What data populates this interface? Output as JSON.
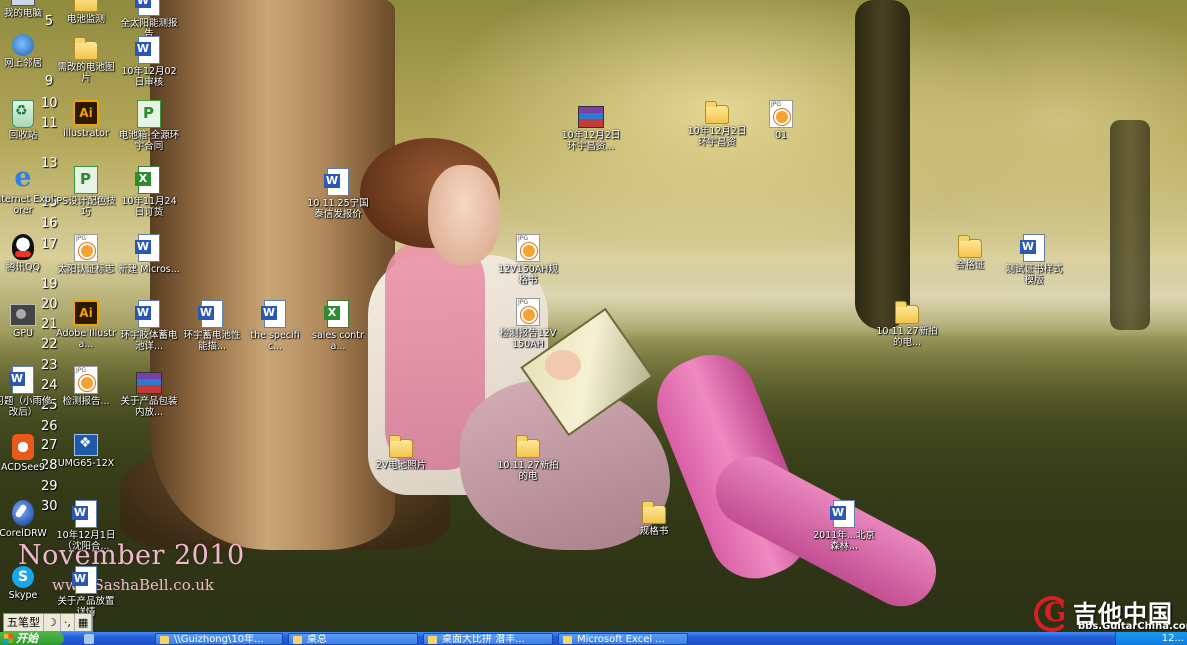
{
  "wallpaper": {
    "title": "November 2010",
    "site": "www.SashaBell.co.uk"
  },
  "left_numbers": [
    "5",
    "9",
    "10",
    "11",
    "13",
    "15",
    "16",
    "17",
    "19",
    "20",
    "21",
    "22",
    "23",
    "24",
    "25",
    "26",
    "27",
    "28",
    "29",
    "30"
  ],
  "desktop_icons": [
    {
      "label": "我的电脑",
      "icon": "computer-icon"
    },
    {
      "label": "电池监测",
      "icon": "folder-icon"
    },
    {
      "label": "全太阳能测报告",
      "icon": "word-icon"
    },
    {
      "label": "网上邻居",
      "icon": "network-icon"
    },
    {
      "label": "需改的电池图片",
      "icon": "folder-icon"
    },
    {
      "label": "10年12月02日审核",
      "icon": "word-icon"
    },
    {
      "label": "回收站",
      "icon": "recycle-bin-icon"
    },
    {
      "label": "illustrator",
      "icon": "illustrator-icon"
    },
    {
      "label": "电池箱-全源环宇合同",
      "icon": "ps-icon"
    },
    {
      "label": "Internet Explorer",
      "icon": "internet-explorer-icon"
    },
    {
      "label": "PS设计配色技巧",
      "icon": "ps-icon"
    },
    {
      "label": "10年11月24日订货",
      "icon": "excel-icon"
    },
    {
      "label": "腾讯QQ",
      "icon": "qq-icon"
    },
    {
      "label": "太阳认证标志",
      "icon": "jpg-icon"
    },
    {
      "label": "新建 Micros...",
      "icon": "word-icon"
    },
    {
      "label": "GPU",
      "icon": "gpu-icon"
    },
    {
      "label": "Adobe Illustra...",
      "icon": "illustrator-icon"
    },
    {
      "label": "环宇胶体蓄电池详...",
      "icon": "word-icon"
    },
    {
      "label": "环宇蓄电池性能描...",
      "icon": "word-icon"
    },
    {
      "label": "the specific...",
      "icon": "word-icon"
    },
    {
      "label": "sales contra...",
      "icon": "excel-icon"
    },
    {
      "label": "习题（小雨修改后）",
      "icon": "word-icon"
    },
    {
      "label": "检测报告...",
      "icon": "jpg-icon"
    },
    {
      "label": "关于产品包装内放...",
      "icon": "rar-icon"
    },
    {
      "label": "ACDSee9",
      "icon": "acdsee-icon"
    },
    {
      "label": "UMG65-12X",
      "icon": "umg-icon"
    },
    {
      "label": "CorelDRW",
      "icon": "coreldraw-icon"
    },
    {
      "label": "10年12月1日（沈阳合...",
      "icon": "word-icon"
    },
    {
      "label": "Skype",
      "icon": "skype-icon"
    },
    {
      "label": "关于产品放置详情",
      "icon": "word-icon"
    },
    {
      "label": "10年12月2日环宇昌资...",
      "icon": "rar-icon"
    },
    {
      "label": "10年12月2日环宇昌资",
      "icon": "folder-icon"
    },
    {
      "label": "01",
      "icon": "jpg-icon"
    },
    {
      "label": "10.11.25宁国泰信发报价",
      "icon": "word-icon"
    },
    {
      "label": "12V150AH规格书",
      "icon": "jpg-icon"
    },
    {
      "label": "检测报告12V150AH",
      "icon": "jpg-icon"
    },
    {
      "label": "合格证",
      "icon": "folder-icon"
    },
    {
      "label": "测试证书样式模版",
      "icon": "word-icon"
    },
    {
      "label": "10.11.27新拍的电...",
      "icon": "folder-icon"
    },
    {
      "label": "2V电池照片",
      "icon": "folder-icon"
    },
    {
      "label": "10.11.27新拍的电",
      "icon": "folder-icon"
    },
    {
      "label": "规格书",
      "icon": "folder-icon"
    },
    {
      "label": "2011年...北京森林...",
      "icon": "word-icon"
    }
  ],
  "ime": {
    "mode": "五笔型",
    "moon": "☽",
    "punct": "·,",
    "keyboard": "▦"
  },
  "taskbar": {
    "start_label": "开始",
    "buttons": [
      {
        "label": "\\\\Guizhong\\10年..."
      },
      {
        "label": "桌总"
      },
      {
        "label": "桌面大比拼 潜丰..."
      },
      {
        "label": "Microsoft Excel ..."
      }
    ],
    "clock": "12..."
  },
  "watermark": {
    "name": "吉他中国",
    "site": "bbs.GuitarChina.com"
  }
}
